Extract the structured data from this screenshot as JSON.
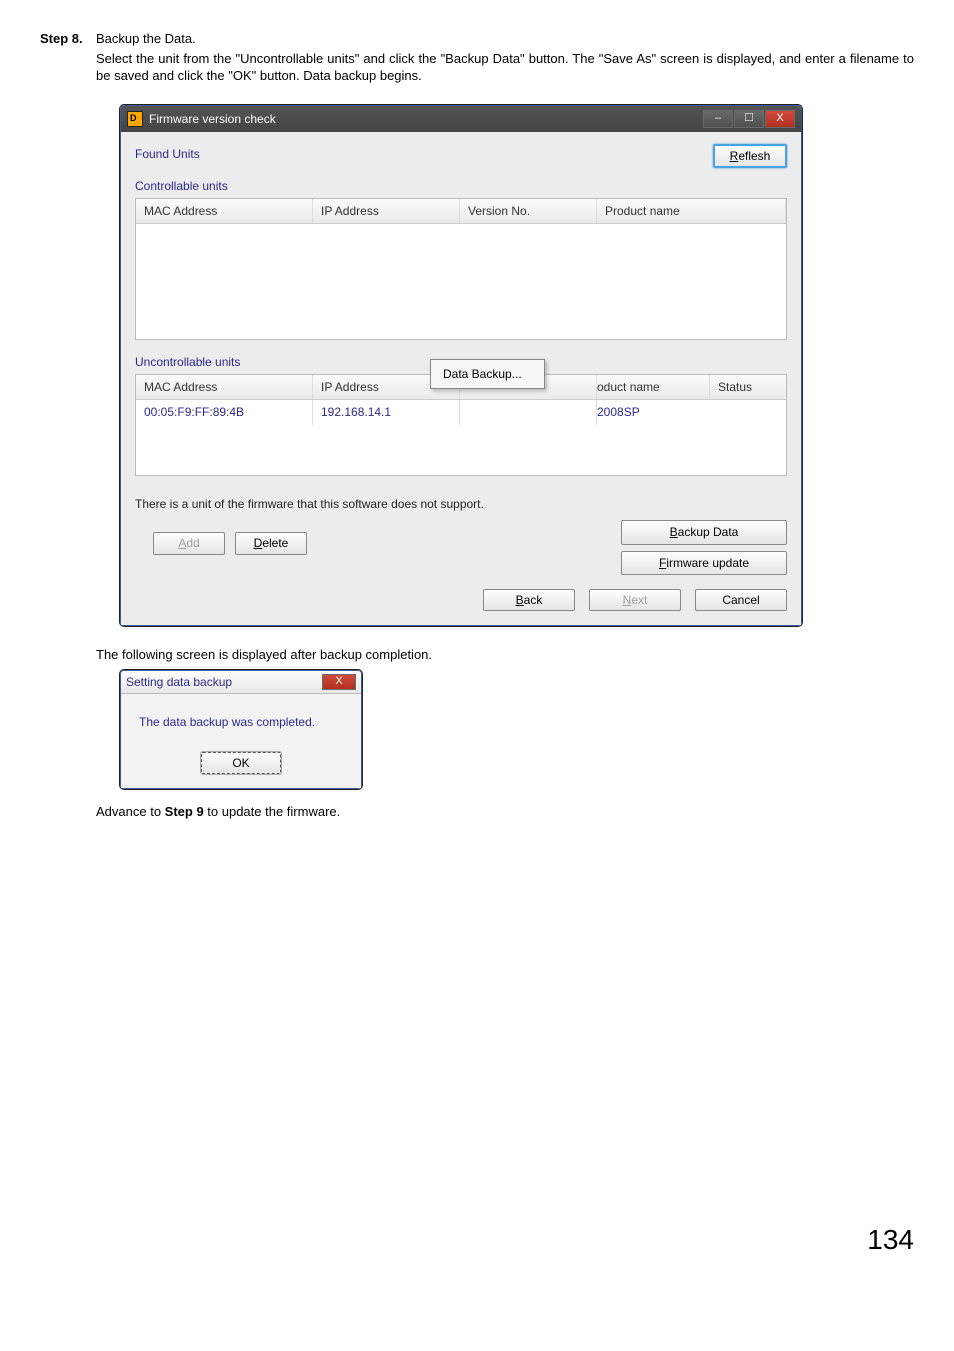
{
  "step": {
    "label": "Step 8.",
    "line1": "Backup the Data.",
    "para": "Select the unit from the \"Uncontrollable units\" and click the \"Backup Data\" button. The \"Save As\" screen is displayed, and enter a filename to be saved and click the \"OK\" button. Data backup begins."
  },
  "window": {
    "title": "Firmware version check",
    "found_label": "Found Units",
    "reflesh": "Reflesh",
    "r_letter": "R",
    "reflesh_rest": "eflesh",
    "controllable_label": "Controllable units",
    "uncontrollable_label": "Uncontrollable units",
    "columns": {
      "mac": "MAC Address",
      "ip": "IP Address",
      "ver": "Version No.",
      "prod": "Product name",
      "prod2_left": "oduct name",
      "status": "Status"
    },
    "row1": {
      "mac": "00:05:F9:FF:89:4B",
      "ip": "192.168.14.1",
      "prod": "2008SP"
    },
    "context_item": "Data Backup...",
    "note": "There is a unit of the firmware that this software does not support.",
    "buttons": {
      "add": "Add",
      "a_letter": "A",
      "add_rest": "dd",
      "delete": "Delete",
      "d_letter": "D",
      "delete_rest": "elete",
      "backup": "Backup Data",
      "b_letter": "B",
      "backup_rest": "ackup Data",
      "firmware": "Firmware update",
      "f_letter": "F",
      "firmware_rest": "irmware update",
      "back": "Back",
      "back_b": "B",
      "back_rest": "ack",
      "next": "Next",
      "n_letter": "N",
      "next_rest": "ext",
      "cancel": "Cancel"
    }
  },
  "after_text": "The following screen is displayed after backup completion.",
  "dialog": {
    "title": "Setting data backup",
    "message": "The data backup was completed.",
    "ok": "OK"
  },
  "advance_text_pre": "Advance to ",
  "advance_text_bold": "Step 9",
  "advance_text_post": " to update the firmware.",
  "page_num": "134"
}
